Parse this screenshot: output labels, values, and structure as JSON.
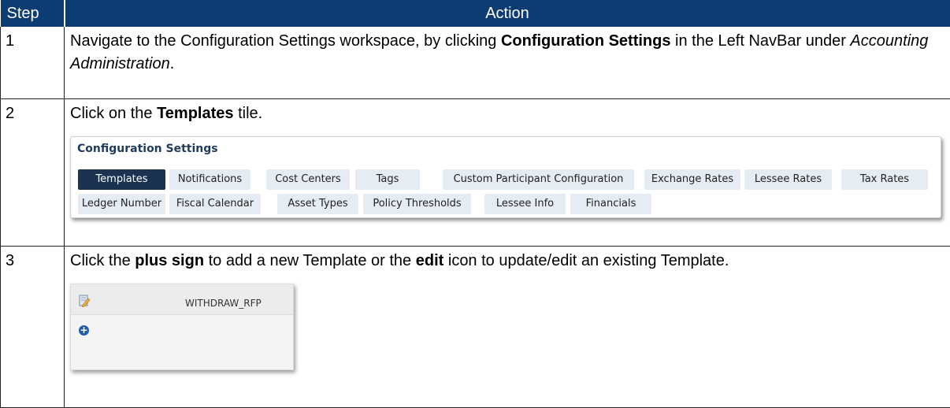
{
  "headers": {
    "step": "Step",
    "action": "Action"
  },
  "steps": [
    {
      "num": "1",
      "parts": [
        "Navigate to the Configuration Settings workspace, by clicking ",
        "Configuration Settings",
        " in the Left NavBar under ",
        "Accounting Administration",
        "."
      ]
    },
    {
      "num": "2",
      "parts": [
        "Click on the ",
        "Templates",
        " tile."
      ]
    },
    {
      "num": "3",
      "parts": [
        "Click the ",
        "plus sign",
        " to add a new Template or the ",
        "edit",
        " icon to update/edit an existing Template."
      ]
    }
  ],
  "config_panel": {
    "title": "Configuration Settings",
    "row1": [
      "Templates",
      "Notifications",
      "Cost Centers",
      "Tags",
      "Custom Participant Configuration",
      "Exchange Rates",
      "Lessee Rates",
      "Tax Rates"
    ],
    "row2": [
      "Ledger Number",
      "Fiscal Calendar",
      "Asset Types",
      "Policy Thresholds",
      "Lessee Info",
      "Financials"
    ],
    "active": "Templates"
  },
  "template_panel": {
    "template_name": "WITHDRAW_RFP",
    "edit_icon": "edit-icon",
    "add_icon": "plus-circle-icon",
    "accent": "#1f5fae"
  },
  "colors": {
    "header_bg": "#0d3b73",
    "active_tile": "#1b3350",
    "tile_bg": "#e6ecf3"
  }
}
